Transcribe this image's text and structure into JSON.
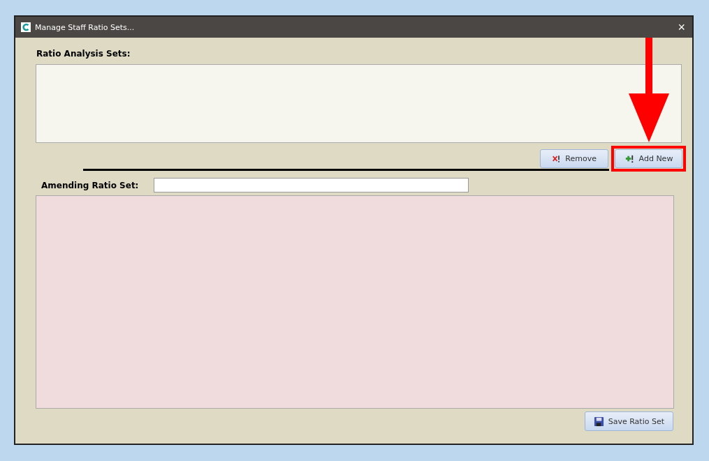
{
  "window": {
    "title": "Manage Staff Ratio Sets...",
    "close": "×"
  },
  "sets": {
    "label": "Ratio Analysis Sets:"
  },
  "buttons": [
    {
      "label": "Remove",
      "kind": "remove"
    },
    {
      "label": "Add New",
      "kind": "add"
    }
  ],
  "amend": {
    "label": "Amending Ratio Set:"
  },
  "save": {
    "label": "Save Ratio Set"
  }
}
